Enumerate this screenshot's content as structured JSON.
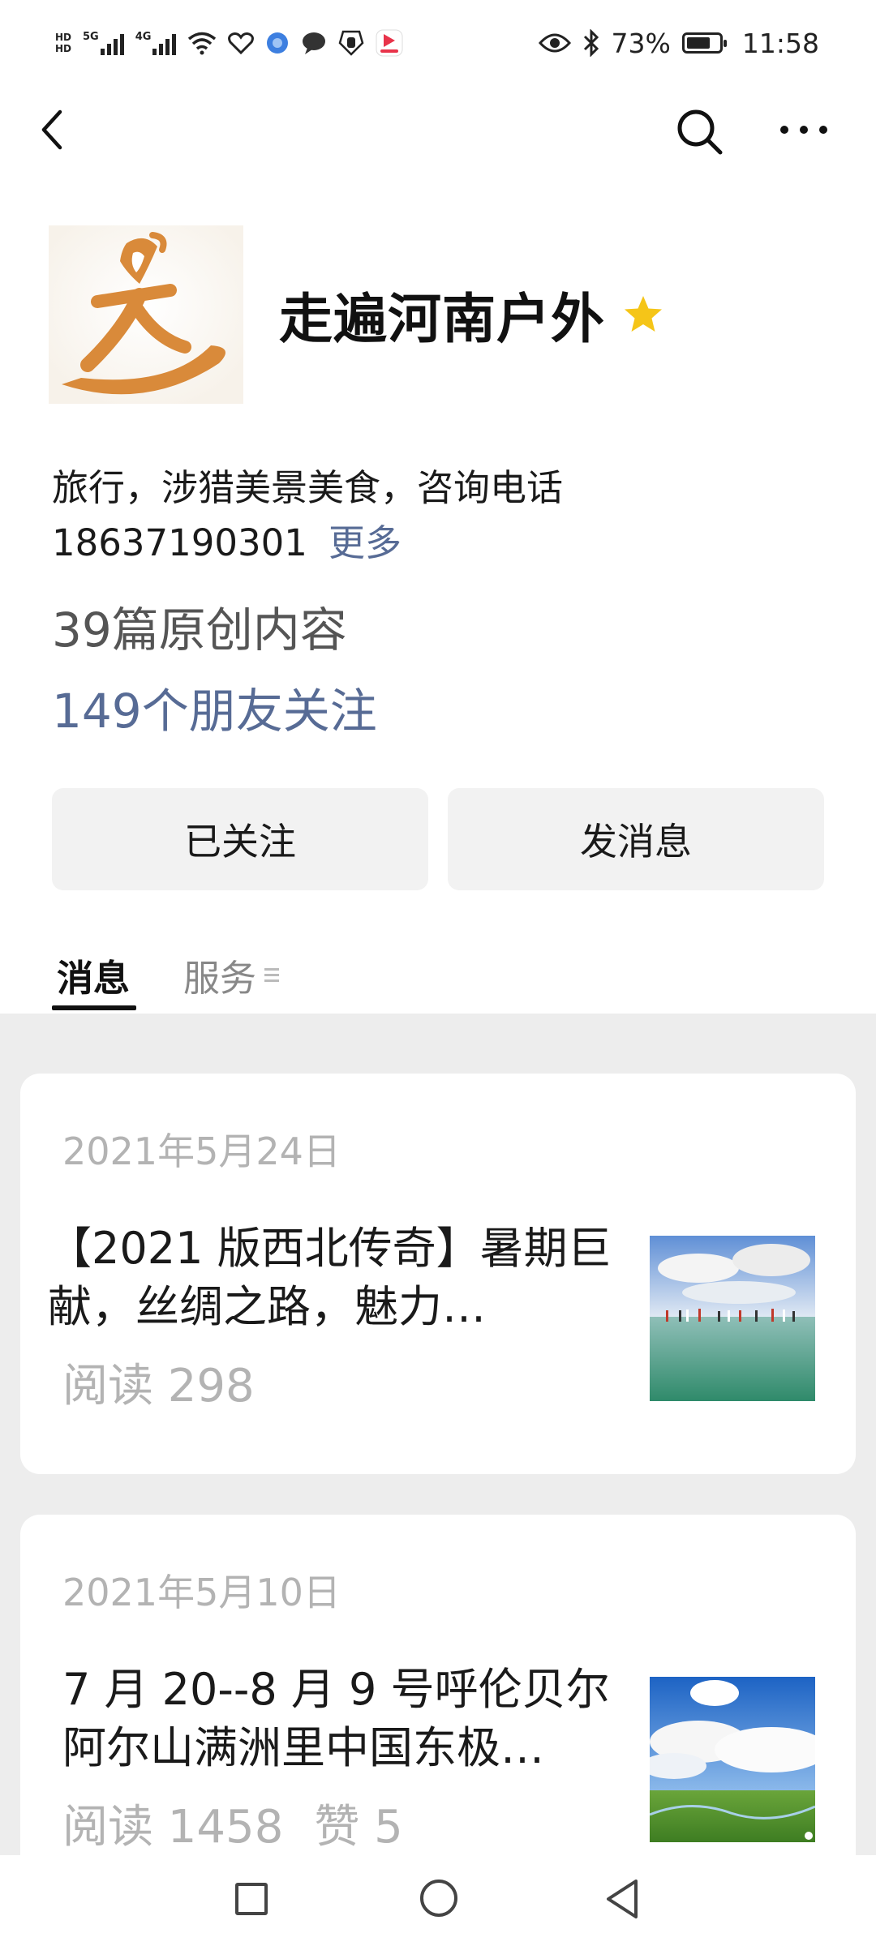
{
  "status_bar": {
    "network_labels": [
      "HD",
      "5G",
      "4G"
    ],
    "battery_percent": "73%",
    "battery_level": 0.73,
    "time": "11:58",
    "icons": [
      "hd-icon",
      "signal-icon",
      "wifi-icon",
      "heart-icon",
      "browser-icon",
      "chat-bubble-icon",
      "hand-icon",
      "app-icon",
      "eye-icon",
      "bluetooth-icon",
      "battery-icon"
    ]
  },
  "nav": {
    "icons": [
      "back-arrow-icon",
      "search-icon",
      "more-icon"
    ]
  },
  "profile": {
    "name": "走遍河南户外",
    "star_icon": "star-icon",
    "description": "旅行，涉猎美景美食，咨询电话 18637190301",
    "more_link": "更多",
    "original_count": "39篇原创内容",
    "friends_following": "149个朋友关注",
    "colors": {
      "link": "#576b95",
      "star": "#f5c518",
      "logo": "#d98a3a"
    }
  },
  "actions": {
    "follow_label": "已关注",
    "message_label": "发消息"
  },
  "tabs": {
    "messages": "消息",
    "services": "服务"
  },
  "feed": [
    {
      "date": "2021年5月24日",
      "title": "【2021 版西北传奇】暑期巨献，丝绸之路，魅力…",
      "reads": "阅读 298",
      "likes": ""
    },
    {
      "date": "2021年5月10日",
      "title": "7 月 20--8 月 9 号呼伦贝尔阿尔山满洲里中国东极…",
      "reads": "阅读 1458",
      "likes": "赞 5"
    }
  ],
  "system_nav": {
    "icons": [
      "recent-apps-icon",
      "home-icon",
      "back-icon"
    ]
  }
}
